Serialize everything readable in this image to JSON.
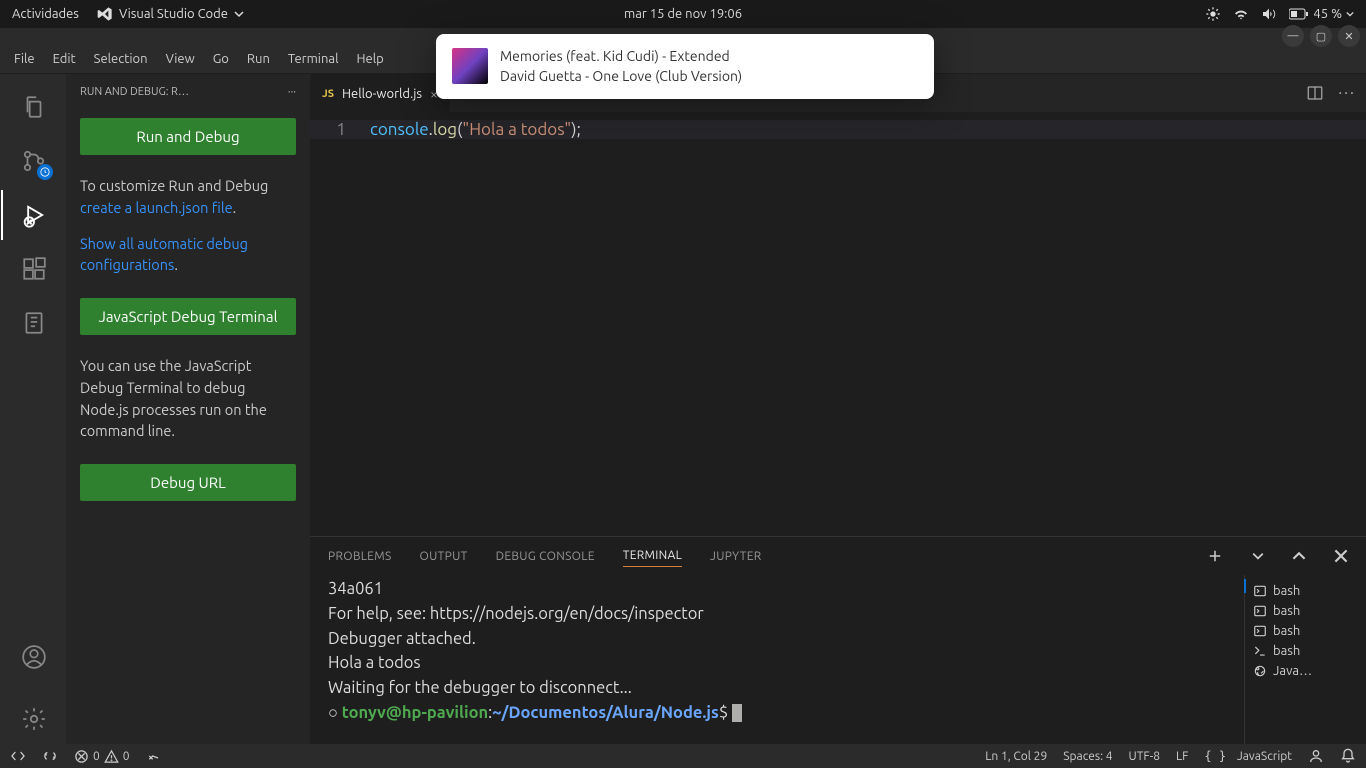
{
  "topbar": {
    "activities": "Actividades",
    "app_name": "Visual Studio Code",
    "datetime": "mar 15 de nov  19:06",
    "battery": "45 %"
  },
  "menu": {
    "file": "File",
    "edit": "Edit",
    "selection": "Selection",
    "view": "View",
    "go": "Go",
    "run": "Run",
    "terminal": "Terminal",
    "help": "Help"
  },
  "sidepanel": {
    "title": "RUN AND DEBUG: R…",
    "more": "···",
    "run_btn": "Run and Debug",
    "customize_pre": "To customize Run and Debug ",
    "customize_link": "create a launch.json file",
    "customize_post": ".",
    "show_link": "Show all automatic debug configurations",
    "show_post": ".",
    "jsterm_btn": "JavaScript Debug Terminal",
    "jsterm_text": "You can use the JavaScript Debug Terminal to debug Node.js processes run on the command line.",
    "debug_url_btn": "Debug URL"
  },
  "tab": {
    "name": "Hello-world.js",
    "icon": "JS"
  },
  "code": {
    "ln": "1",
    "obj": "console",
    "dot": ".",
    "fn": "log",
    "lp": "(",
    "str": "\"Hola a todos\"",
    "rp": ")",
    "sc": ";"
  },
  "panels": {
    "p1": "PROBLEMS",
    "p2": "OUTPUT",
    "p3": "DEBUG CONSOLE",
    "p4": "TERMINAL",
    "p5": "JUPYTER"
  },
  "termside": {
    "b1": "bash",
    "b2": "bash",
    "b3": "bash",
    "b4": "bash",
    "b5": "Java…"
  },
  "terminal": {
    "l1": "34a061",
    "l2": "For help, see: https://nodejs.org/en/docs/inspector",
    "l3": "Debugger attached.",
    "l4": "Hola a todos",
    "l5": "Waiting for the debugger to disconnect...",
    "prompt_circle": "○ ",
    "prompt_user": "tonyv@hp-pavilion",
    "prompt_colon": ":",
    "prompt_path": "~/Documentos/Alura/Node.js",
    "prompt_cash": "$ "
  },
  "status": {
    "errors": "0",
    "warnings": "0",
    "ln_col": "Ln 1, Col 29",
    "spaces": "Spaces: 4",
    "encoding": "UTF-8",
    "eol": "LF",
    "lang": "JavaScript"
  },
  "notif": {
    "title": "Memories (feat. Kid Cudi) - Extended",
    "subtitle": "David Guetta - One Love (Club Version)"
  }
}
